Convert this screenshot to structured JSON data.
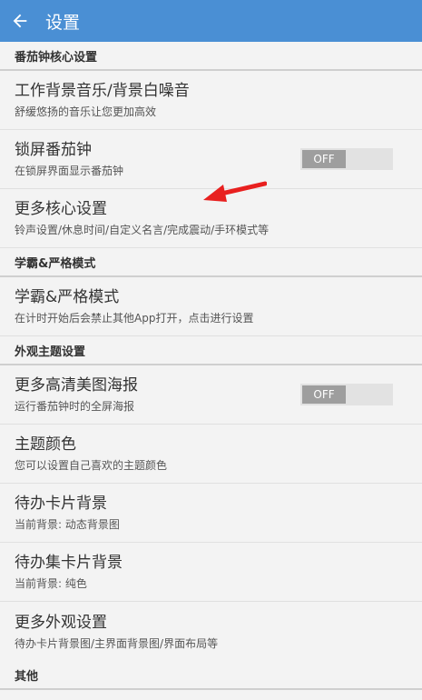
{
  "appbar": {
    "title": "设置"
  },
  "sections": {
    "core": {
      "header": "番茄钟核心设置",
      "bgmusic": {
        "title": "工作背景音乐/背景白噪音",
        "sub": "舒缓悠扬的音乐让您更加高效"
      },
      "lock": {
        "title": "锁屏番茄钟",
        "sub": "在锁屏界面显示番茄钟",
        "toggle": "OFF"
      },
      "more": {
        "title": "更多核心设置",
        "sub": "铃声设置/休息时间/自定义名言/完成震动/手环模式等"
      }
    },
    "strict": {
      "header": "学霸&严格模式",
      "mode": {
        "title": "学霸&严格模式",
        "sub": "在计时开始后会禁止其他App打开，点击进行设置"
      }
    },
    "theme": {
      "header": "外观主题设置",
      "poster": {
        "title": "更多高清美图海报",
        "sub": "运行番茄钟时的全屏海报",
        "toggle": "OFF"
      },
      "color": {
        "title": "主题颜色",
        "sub": "您可以设置自己喜欢的主题颜色"
      },
      "todo_bg": {
        "title": "待办卡片背景",
        "sub": "当前背景: 动态背景图"
      },
      "todoset_bg": {
        "title": "待办集卡片背景",
        "sub": "当前背景: 纯色"
      },
      "more": {
        "title": "更多外观设置",
        "sub": "待办卡片背景图/主界面背景图/界面布局等"
      }
    },
    "other": {
      "header": "其他"
    }
  },
  "annotation": {
    "icon": "red-arrow-icon",
    "color": "#e8201f"
  }
}
